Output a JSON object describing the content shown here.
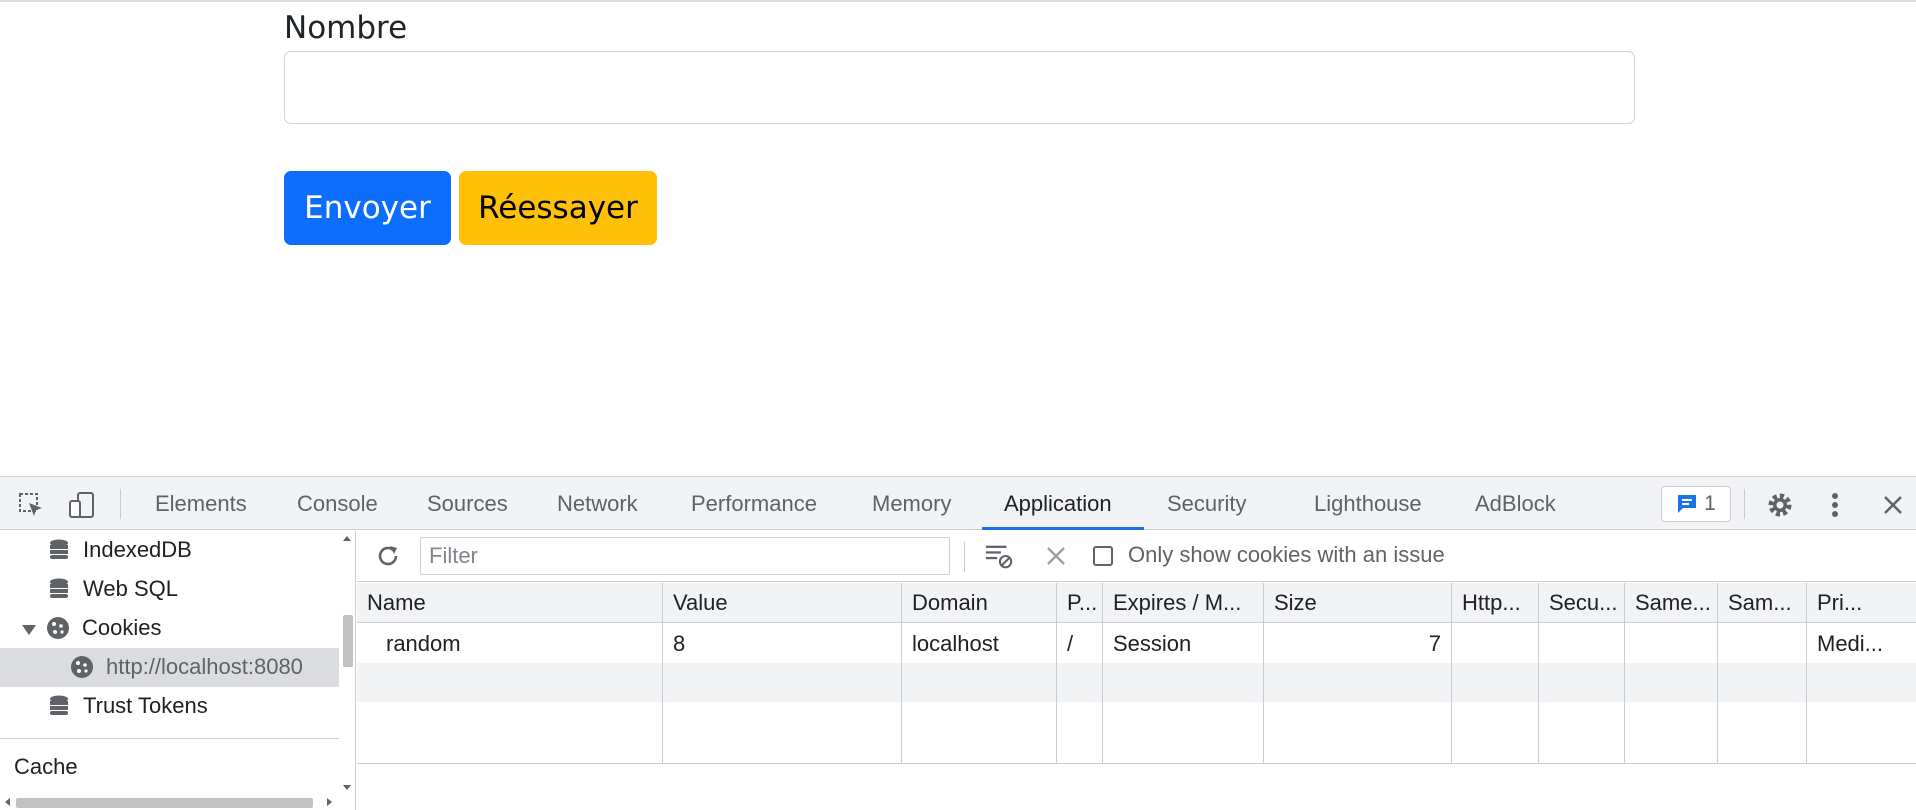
{
  "form": {
    "label": "Nombre",
    "input_value": "",
    "submit_label": "Envoyer",
    "retry_label": "Réessayer"
  },
  "devtools": {
    "tabs": [
      "Elements",
      "Console",
      "Sources",
      "Network",
      "Performance",
      "Memory",
      "Application",
      "Security",
      "Lighthouse",
      "AdBlock"
    ],
    "active_tab": "Application",
    "issues_count": "1",
    "sidebar": {
      "items": [
        {
          "label": "IndexedDB",
          "icon": "database-icon"
        },
        {
          "label": "Web SQL",
          "icon": "database-icon"
        },
        {
          "label": "Cookies",
          "icon": "cookie-icon"
        },
        {
          "label": "http://localhost:8080",
          "icon": "cookie-icon",
          "selected": true
        },
        {
          "label": "Trust Tokens",
          "icon": "database-icon"
        }
      ],
      "section": "Cache"
    },
    "toolbar": {
      "filter_placeholder": "Filter",
      "only_issues_label": "Only show cookies with an issue"
    },
    "table": {
      "headers": [
        "Name",
        "Value",
        "Domain",
        "P...",
        "Expires / M...",
        "Size",
        "Http...",
        "Secu...",
        "Same...",
        "Sam...",
        "Pri..."
      ],
      "rows": [
        [
          "random",
          "8",
          "localhost",
          "/",
          "Session",
          "7",
          "",
          "",
          "",
          "",
          "Medi..."
        ]
      ]
    }
  },
  "colors": {
    "primary": "#0d6efd",
    "warning": "#ffc107",
    "devtools_accent": "#1a73e8"
  }
}
